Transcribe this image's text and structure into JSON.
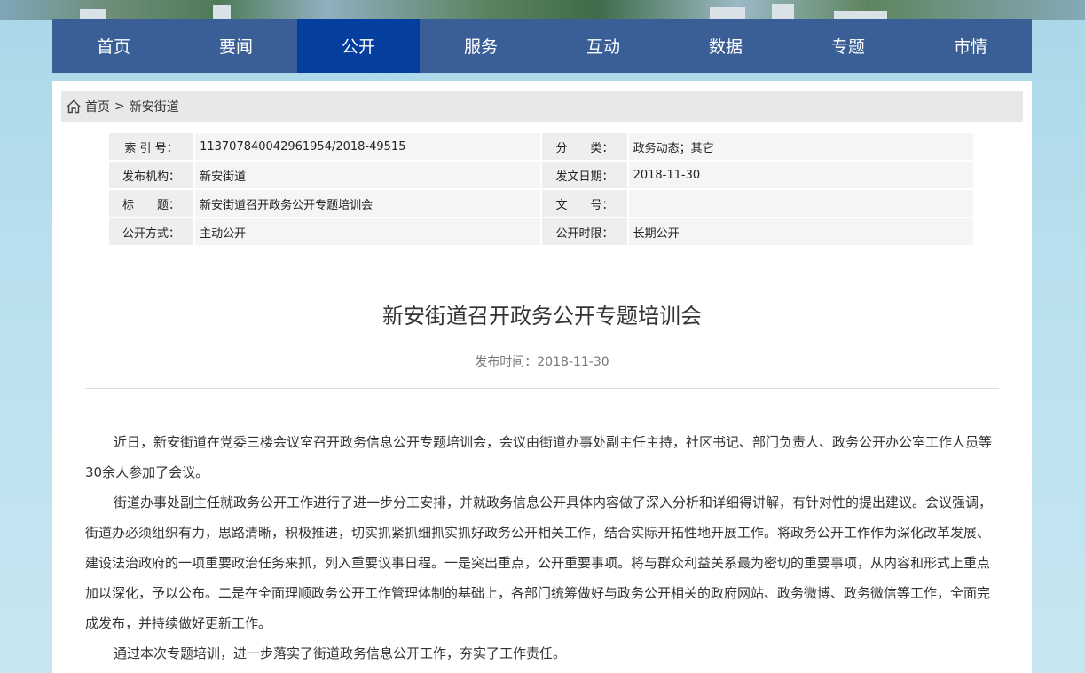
{
  "nav": {
    "items": [
      {
        "label": "首页"
      },
      {
        "label": "要闻"
      },
      {
        "label": "公开"
      },
      {
        "label": "服务"
      },
      {
        "label": "互动"
      },
      {
        "label": "数据"
      },
      {
        "label": "专题"
      },
      {
        "label": "市情"
      }
    ],
    "active_index": 2,
    "bg_color": "#3a5f97",
    "active_color": "#043e9e"
  },
  "breadcrumb": {
    "home_icon": "home-icon",
    "home": "首页",
    "separator": ">",
    "current": "新安街道"
  },
  "meta": {
    "index_label": "索 引 号：",
    "index_value": "113707840042961954/2018-49515",
    "category_label": "分　　类：",
    "category_value": "政务动态；其它",
    "publisher_label": "发布机构：",
    "publisher_value": "新安街道",
    "date_label": "发文日期：",
    "date_value": "2018-11-30",
    "title_label": "标　　题：",
    "title_value": "新安街道召开政务公开专题培训会",
    "docno_label": "文　　号：",
    "docno_value": "",
    "method_label": "公开方式：",
    "method_value": "主动公开",
    "term_label": "公开时限：",
    "term_value": "长期公开"
  },
  "article": {
    "title": "新安街道召开政务公开专题培训会",
    "pubtime": "发布时间：2018-11-30",
    "paragraphs": [
      "近日，新安街道在党委三楼会议室召开政务信息公开专题培训会，会议由街道办事处副主任主持，社区书记、部门负责人、政务公开办公室工作人员等30余人参加了会议。",
      "街道办事处副主任就政务公开工作进行了进一步分工安排，并就政务信息公开具体内容做了深入分析和详细得讲解，有针对性的提出建议。会议强调，街道办必须组织有力，思路清晰，积极推进，切实抓紧抓细抓实抓好政务公开相关工作，结合实际开拓性地开展工作。将政务公开工作作为深化改革发展、建设法治政府的一项重要政治任务来抓，列入重要议事日程。一是突出重点，公开重要事项。将与群众利益关系最为密切的重要事项，从内容和形式上重点加以深化，予以公布。二是在全面理顺政务公开工作管理体制的基础上，各部门统筹做好与政务公开相关的政府网站、政务微博、政务微信等工作，全面完成发布，并持续做好更新工作。",
      "通过本次专题培训，进一步落实了街道政务信息公开工作，夯实了工作责任。"
    ]
  }
}
